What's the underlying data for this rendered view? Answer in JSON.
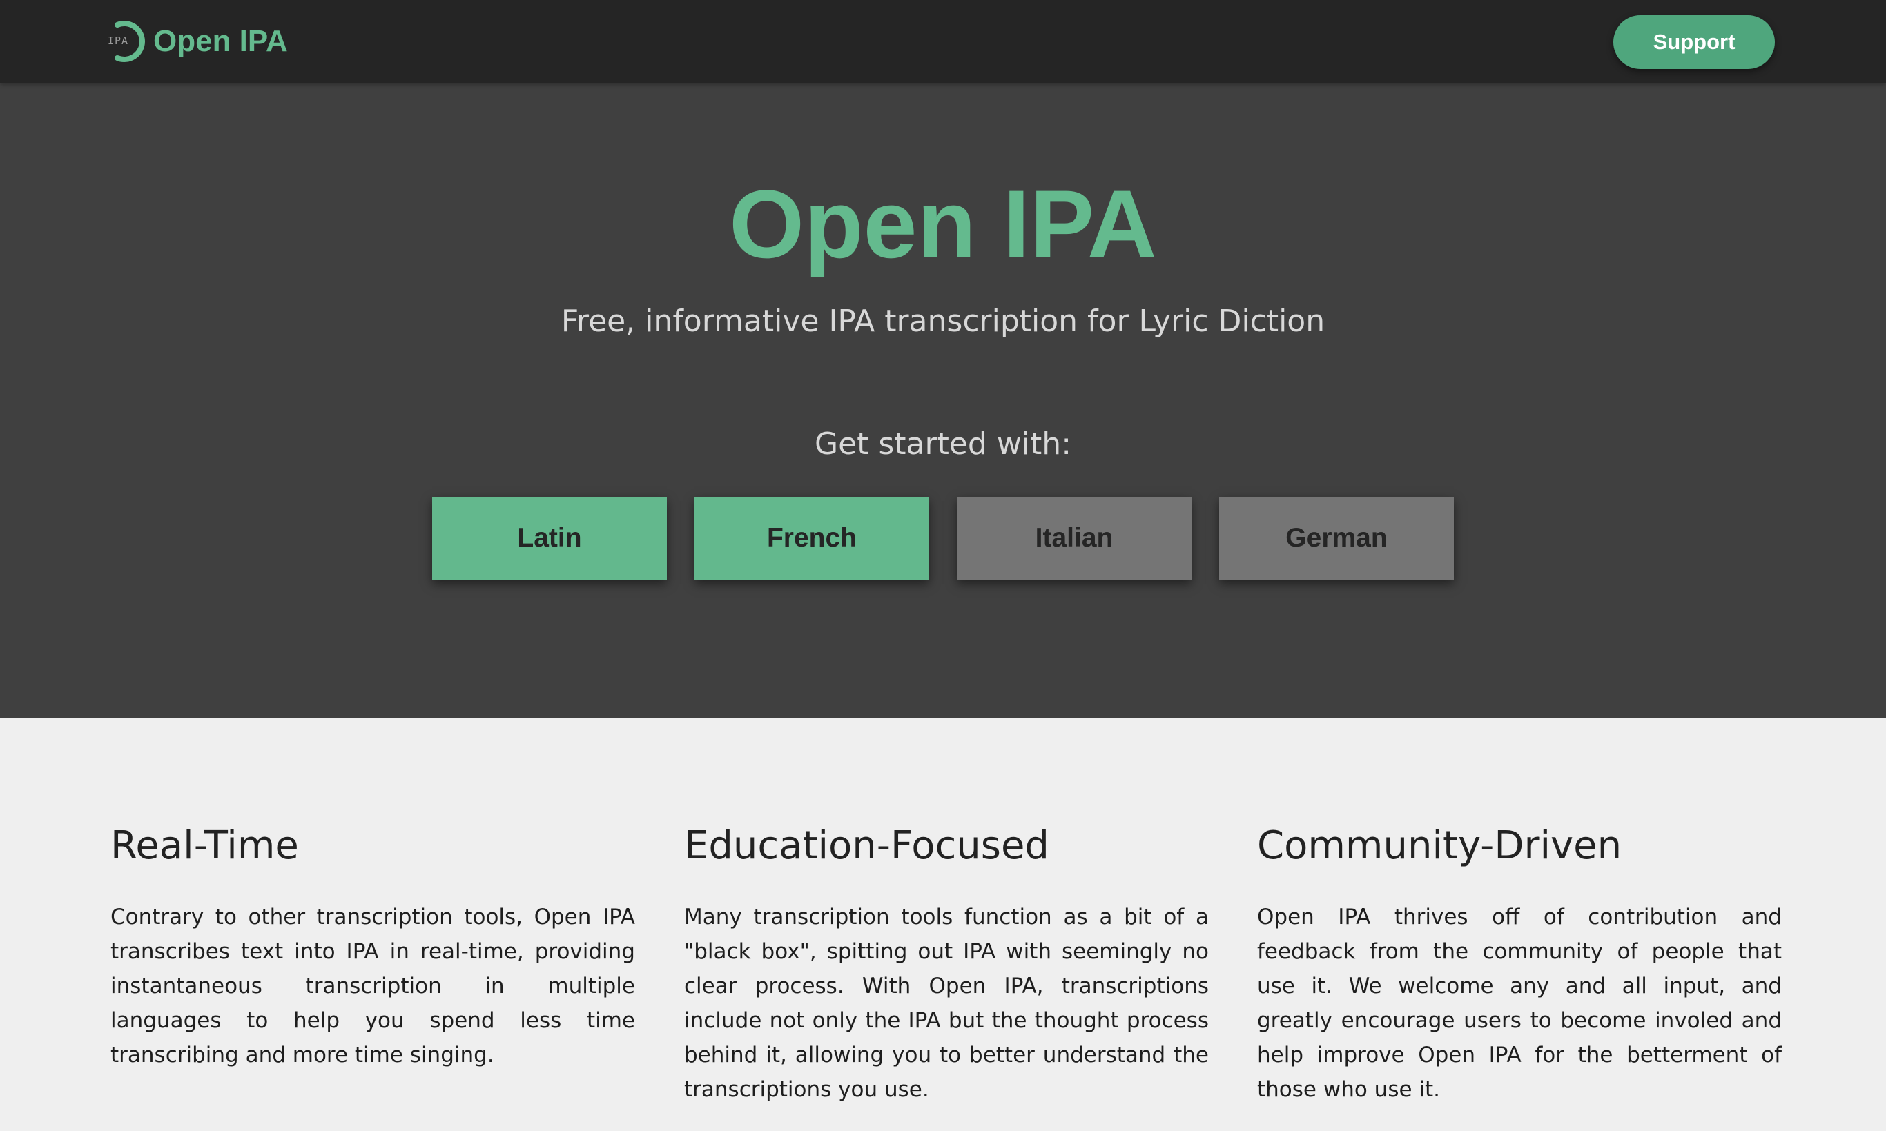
{
  "navbar": {
    "logo_text": "IPA",
    "brand_name": "Open IPA",
    "support_label": "Support"
  },
  "hero": {
    "title": "Open IPA",
    "subtitle": "Free, informative IPA transcription for Lyric Diction",
    "get_started": "Get started with:",
    "languages": [
      {
        "label": "Latin",
        "active": true
      },
      {
        "label": "French",
        "active": true
      },
      {
        "label": "Italian",
        "active": false
      },
      {
        "label": "German",
        "active": false
      }
    ]
  },
  "features": [
    {
      "heading": "Real-Time",
      "body": "Contrary to other transcription tools, Open IPA transcribes text into IPA in real-time, providing instantaneous transcription in multiple languages to help you spend less time transcribing and more time singing."
    },
    {
      "heading": "Education-Focused",
      "body": "Many transcription tools function as a bit of a \"black box\", spitting out IPA with seemingly no clear process. With Open IPA, transcriptions include not only the IPA but the thought process behind it, allowing you to better understand the transcriptions you use."
    },
    {
      "heading": "Community-Driven",
      "body": "Open IPA thrives off of contribution and feedback from the community of people that use it. We welcome any and all input, and greatly encourage users to become involed and help improve Open IPA for the betterment of those who use it."
    }
  ],
  "colors": {
    "brand_green": "#64ba8e",
    "support_green": "#4fa67d",
    "navbar_bg": "#252525",
    "hero_bg": "#404040",
    "inactive_button": "#757575",
    "page_bg": "#efefef"
  },
  "icons": {
    "logo": "open-ipa-ring-logo-icon"
  }
}
